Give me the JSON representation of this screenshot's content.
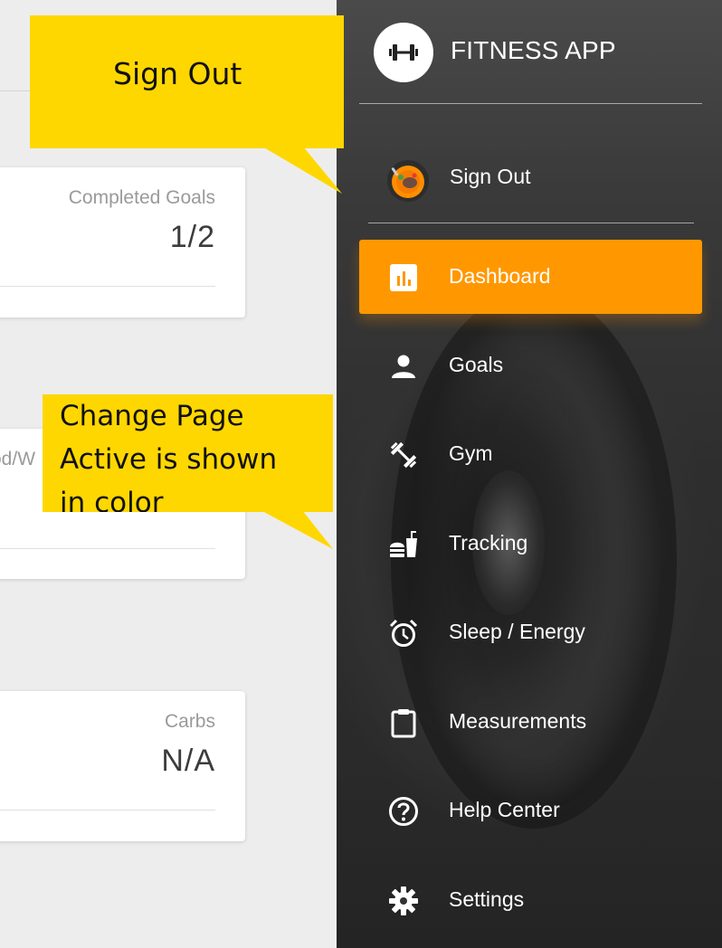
{
  "main": {
    "cards": [
      {
        "label": "Completed Goals",
        "value": "1/2"
      },
      {
        "label": "od/W",
        "value": ""
      },
      {
        "label": "Carbs",
        "value": "N/A"
      }
    ]
  },
  "sidebar": {
    "app_title": "FITNESS APP",
    "sign_out": "Sign Out",
    "nav": [
      {
        "label": "Dashboard",
        "icon": "bar-chart-icon",
        "active": true
      },
      {
        "label": "Goals",
        "icon": "person-icon"
      },
      {
        "label": "Gym",
        "icon": "dumbbell-icon"
      },
      {
        "label": "Tracking",
        "icon": "fast-food-icon"
      },
      {
        "label": "Sleep / Energy",
        "icon": "alarm-clock-icon"
      },
      {
        "label": "Measurements",
        "icon": "clipboard-icon"
      },
      {
        "label": "Help Center",
        "icon": "help-circle-icon"
      },
      {
        "label": "Settings",
        "icon": "gear-icon"
      }
    ],
    "active_color": "#ff9800"
  },
  "callouts": {
    "sign_out": "Sign Out",
    "change_page": "Change Page\nActive is shown\nin color",
    "color": "#ffd700"
  }
}
